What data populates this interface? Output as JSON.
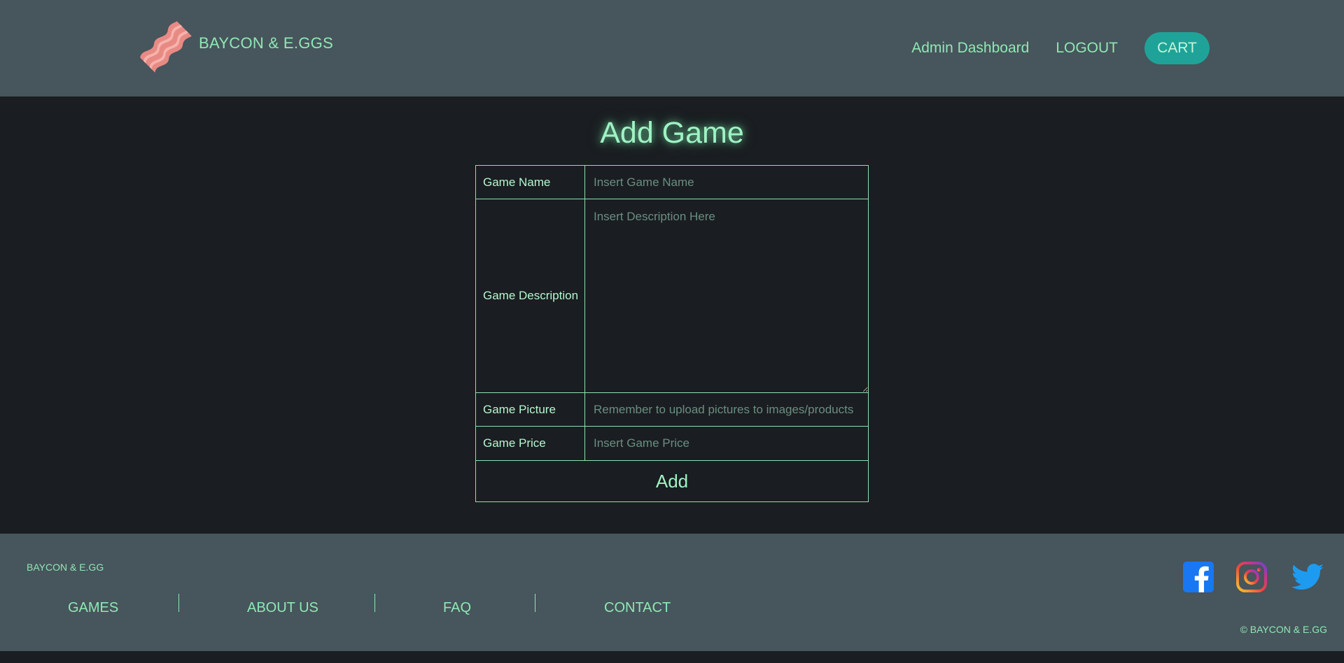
{
  "header": {
    "brand": "BAYCON & E.GGS",
    "nav": {
      "admin_dashboard": "Admin Dashboard",
      "logout": "LOGOUT",
      "cart": "CART"
    }
  },
  "main": {
    "title": "Add Game",
    "form": {
      "name_label": "Game Name",
      "name_placeholder": "Insert Game Name",
      "description_label": "Game Description",
      "description_placeholder": "Insert Description Here",
      "picture_label": "Game Picture",
      "picture_placeholder": "Remember to upload pictures to images/products",
      "price_label": "Game Price",
      "price_placeholder": "Insert Game Price",
      "submit_label": "Add"
    }
  },
  "footer": {
    "brand": "BAYCON & E.GG",
    "links": [
      "GAMES",
      "ABOUT US",
      "FAQ",
      "CONTACT"
    ],
    "social": [
      "facebook-icon",
      "instagram-icon",
      "twitter-icon"
    ],
    "copyright": "© BAYCON & E.GG"
  },
  "colors": {
    "header_bg": "#47555c",
    "page_bg": "#1a1d21",
    "accent": "#8fe8b4",
    "cart_button": "#1fa399",
    "facebook": "#1877f2",
    "twitter": "#1d9bf0"
  }
}
